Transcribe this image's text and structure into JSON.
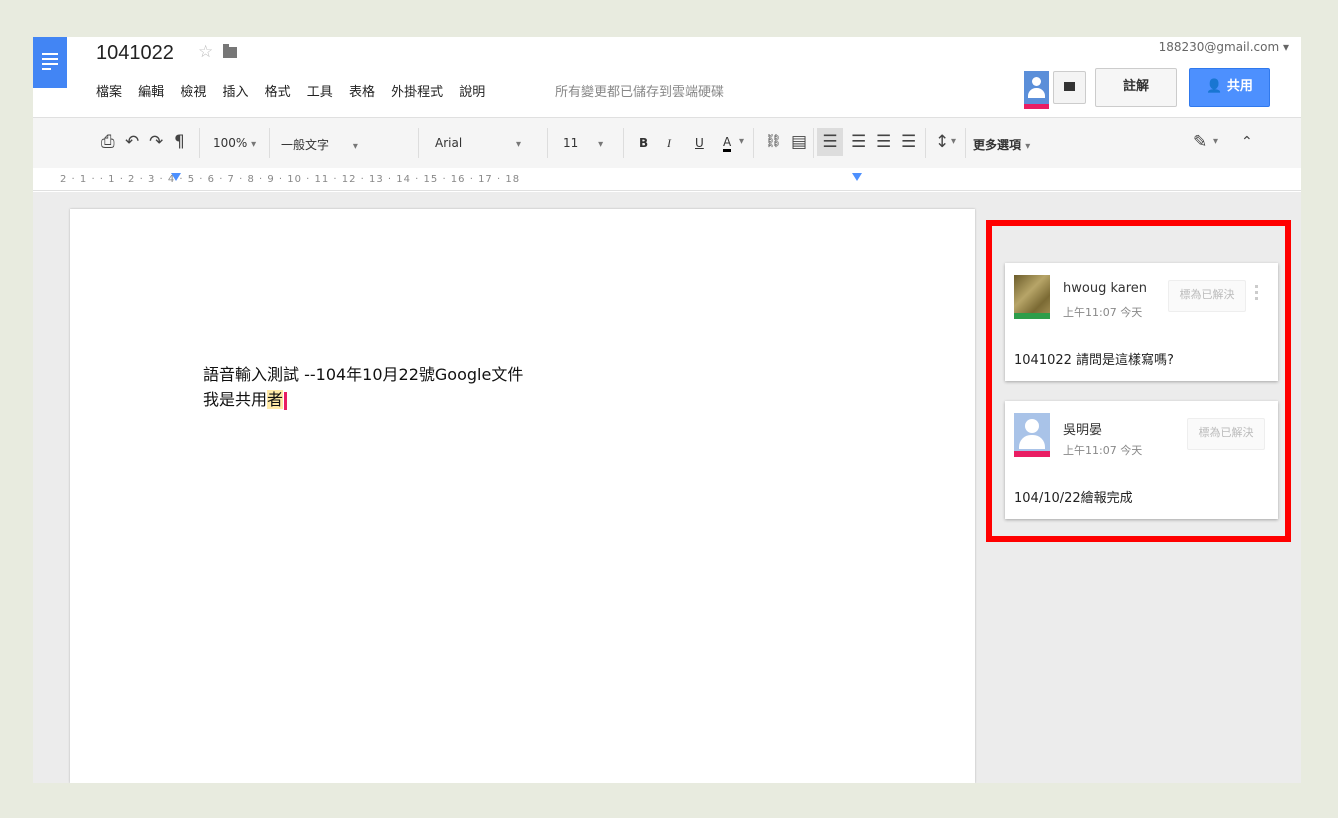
{
  "header": {
    "title": "1041022",
    "account": "188230@gmail.com ▾",
    "save_status": "所有變更都已儲存到雲端硬碟",
    "comments_label": "註解",
    "share_label": "共用",
    "menu": [
      "檔案",
      "編輯",
      "檢視",
      "插入",
      "格式",
      "工具",
      "表格",
      "外掛程式",
      "說明"
    ]
  },
  "toolbar": {
    "zoom": "100%",
    "style": "一般文字",
    "font": "Arial",
    "size": "11",
    "bold": "B",
    "italic": "I",
    "underline": "U",
    "text_color": "A",
    "more": "更多選項"
  },
  "ruler": {
    "text": "2 · 1 · · 1 · 2 · 3 · 4 · 5 · 6 · 7 · 8 · 9 · 10 · 11 · 12 · 13 · 14 · 15 · 16 · 17 · 18"
  },
  "document": {
    "line1": "語音輸入測試 --104年10月22號Google文件",
    "line2_main": "我是共用",
    "line2_highlight": "者"
  },
  "comments": [
    {
      "author": "hwoug karen",
      "time": "上午11:07 今天",
      "resolve_label": "標為已解決",
      "text": "1041022 請問是這樣寫嗎?"
    },
    {
      "author": "吳明晏",
      "time": "上午11:07 今天",
      "resolve_label": "標為已解決",
      "text": "104/10/22繪報完成"
    }
  ],
  "colors": {
    "brand_blue": "#4285f4",
    "share_button": "#4d90fe",
    "highlight_box": "#ff0000",
    "presence_pink": "#e91e63"
  }
}
